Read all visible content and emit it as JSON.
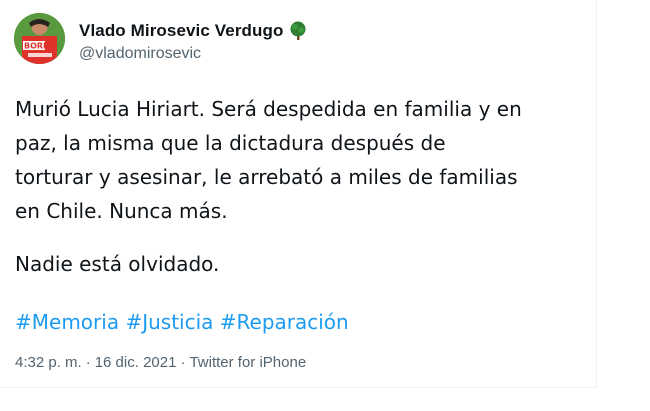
{
  "author": {
    "display_name": "Vlado Mirosevic Verdugo",
    "handle": "@vladomirosevic",
    "badge_icon": "tree-icon",
    "avatar_text": "BORIC"
  },
  "tweet": {
    "text_paragraph_1": "Murió Lucia Hiriart. Será despedida en familia y en\npaz, la misma que la dictadura después de\ntorturar y asesinar, le arrebató a miles de familias\nen Chile. Nunca más.",
    "text_paragraph_2": "Nadie está olvidado.",
    "hashtags": [
      "#Memoria",
      "#Justicia",
      "#Reparación"
    ]
  },
  "meta": {
    "time": "4:32 p. m.",
    "separator": "·",
    "date": "16 dic. 2021",
    "source": "Twitter for iPhone"
  },
  "colors": {
    "link": "#1d9bf0",
    "secondary_text": "#536471",
    "primary_text": "#0f1419"
  }
}
